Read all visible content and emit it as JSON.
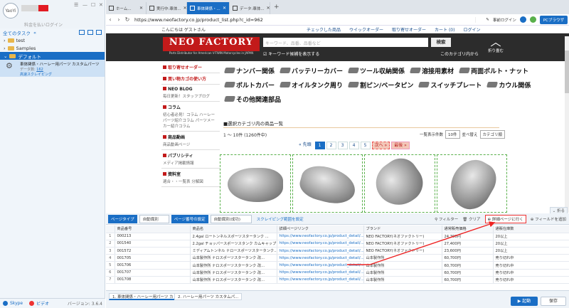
{
  "app": {
    "login_note": "料金を払いログイン",
    "all_tasks": "全てのタスク",
    "tree": [
      {
        "label": "test"
      },
      {
        "label": "Samples"
      },
      {
        "label": "デフォルト"
      }
    ],
    "task": {
      "title": "車体関係・ハーレー用パーツ カスタムパーツ",
      "meta_label": "データ数:",
      "meta_value": "162",
      "link": "高速スクレイピング"
    },
    "footer": {
      "skype": "Skype",
      "video": "ビデオ",
      "version": "バージョン: 3.6.4"
    },
    "browser_tabs": [
      {
        "label": "ホーム..."
      },
      {
        "label": "実行中:車体..."
      },
      {
        "label": "車体関係・..."
      },
      {
        "label": "データ:車体..."
      }
    ],
    "url": "https://www.neofactory.co.jp/product_list.php?c_id=962",
    "url_right": {
      "pre_login": "事前ログイン",
      "pc_browser": "PCブラウザ"
    }
  },
  "site": {
    "greeting": "こんにちは ゲストさん",
    "top_links": [
      "チェックした商品",
      "ウイックオーダー",
      "取り寄せオーダー",
      "カート (0)",
      "ログイン"
    ],
    "logo": "NEO FACTORY",
    "logo_sub": "Parts Distributor for American V-TWIN Motorcycles in JAPAN",
    "search_placeholder": "キーワード、品番、品番など",
    "search_btn": "検索",
    "keyword_check": "キーワード候補を表示する",
    "in_category": "このカテゴリ内から",
    "fold": "折り畳む",
    "left_menu": [
      {
        "head": "取り寄せオーダー",
        "sub": "",
        "red": true
      },
      {
        "head": "買い物カゴの使い方",
        "sub": "",
        "red": true
      },
      {
        "head": "NEO BLOG",
        "sub": "毎日更新！スタッフブログ",
        "red": false
      },
      {
        "head": "コラム",
        "sub": "初心者必見！コラム ハーレーパーツ紹介コラム パーツメーカー紹介コラム",
        "red": false
      },
      {
        "head": "商品動画",
        "sub": "商品動画ページ",
        "red": false
      },
      {
        "head": "パブリシティ",
        "sub": "メディア掲載情報",
        "red": false
      },
      {
        "head": "資料室",
        "sub": "適合・・一覧表 分解図",
        "red": false
      }
    ],
    "categories": [
      [
        "ナンバー関係",
        "バッテリーカバー",
        "ツール収納関係",
        "溶接用素材",
        "両面ボルト・ナット"
      ],
      [
        "ボルトカバー",
        "オイルタンク周り",
        "割ピン/ベータピン",
        "スイッチプレート",
        "カウル関係"
      ],
      [
        "その他関連部品"
      ]
    ],
    "section_title": "■選択カテゴリ内の商品一覧",
    "count": "1 〜 10件 (1260件中)",
    "per_page_label": "一覧表示件数",
    "per_page_value": "10件",
    "sort_label": "並べ替え",
    "sort_value": "カテゴリ順",
    "pager": {
      "prev": "先頭",
      "pages": [
        "1",
        "2",
        "3",
        "4",
        "5"
      ],
      "next": "次へ",
      "last": "最後"
    },
    "fold_btn": "折る"
  },
  "toolbar": {
    "page_type_label": "ページタイプ",
    "page_type_value": "自動識別",
    "page_num_label": "ページ番号の設定",
    "page_num_value": "自動識別(成功)",
    "scrape_range": "スクレイピング範囲を設定",
    "filter": "フィルター",
    "clear": "クリア",
    "detail": "詳細ページに行く",
    "add_field": "フィールドを追加"
  },
  "table": {
    "columns": [
      "商品番号",
      "商品名",
      "詳細ページリンク",
      "ブランド",
      "通常販売価格",
      "通販在庫数"
    ],
    "rows": [
      [
        "000213",
        "2.4gal ロートンネルスポーツスタータンク ...",
        "https://www.neofactory.co.jp/product_detail/...",
        "NEO FACTORY(ネオファクトリー)",
        "24,300円",
        "20以上"
      ],
      [
        "001540",
        "2.2gal チョッパースポーツスタンク カムキャップ",
        "https://www.neofactory.co.jp/product_detail/...",
        "NEO FACTORY(ネオファクトリー)",
        "27,400円",
        "20以上"
      ],
      [
        "001572",
        "ミディアムトンネル ナロースポーツスタータンク...",
        "https://www.neofactory.co.jp/product_detail/...",
        "NEO FACTORY(ネオファクトリー)",
        "23,600円",
        "20以上"
      ],
      [
        "001705",
        "山本製作所 ナロスポーツスタータンク 改...",
        "https://www.neofactory.co.jp/product_detail/...",
        "山本製作所",
        "60,700円",
        "売り切れ中"
      ],
      [
        "001706",
        "山本製作所 ナロスポーツスタータンク 改...",
        "https://www.neofactory.co.jp/product_detail/...",
        "山本製作所",
        "60,700円",
        "売り切れ中"
      ],
      [
        "001707",
        "山本製作所 ナロスポーツスタータンク 改...",
        "https://www.neofactory.co.jp/product_detail/...",
        "山本製作所",
        "60,700円",
        "売り切れ中"
      ],
      [
        "001708",
        "山本製作所 ナロスポーツスタータンク 改...",
        "https://www.neofactory.co.jp/product_detail/...",
        "山本製作所",
        "60,700円",
        "売り切れ中"
      ]
    ]
  },
  "bottom": {
    "tabs": [
      "1. 車体関係・ハーレー用パーツ カ",
      "2. ハーレー用パーツ カスタムパ..."
    ],
    "run": "起動",
    "save": "保存"
  }
}
